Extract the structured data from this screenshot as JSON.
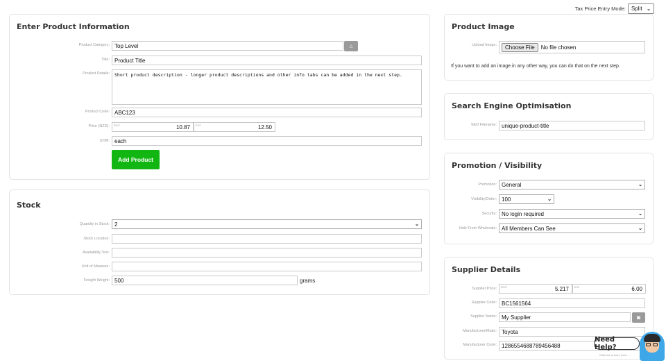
{
  "tax_mode": {
    "label": "Tax Price Entry Mode:",
    "value": "Split"
  },
  "product_info": {
    "title": "Enter Product Information",
    "category_label": "Product Category:",
    "category_value": "Top Level",
    "title_label": "Title:",
    "title_value": "Product Title",
    "details_label": "Product Details:",
    "details_value": "Short product description - longer product descriptions and other info tabs can be added in the next step.",
    "code_label": "Product Code:",
    "code_value": "ABC123",
    "price_label": "Price (NZD):",
    "price_excl_tag": "Excl",
    "price_excl": "10.87",
    "price_incl_tag": "Incl",
    "price_incl": "12.50",
    "uom_label": "UOM:",
    "uom_value": "each",
    "add_button": "Add Product"
  },
  "stock": {
    "title": "Stock",
    "qty_label": "Quantity in Stock:",
    "qty_value": "2",
    "location_label": "Stock Location:",
    "availability_label": "Availability Text:",
    "unit_label": "Unit of Measure:",
    "freight_label": "Freight Weight:",
    "freight_value": "500",
    "freight_unit": "grams"
  },
  "product_image": {
    "title": "Product Image",
    "upload_label": "Upload Image:",
    "choose_button": "Choose File",
    "no_file": "No file chosen",
    "note": "If you want to add an image in any other way, you can do that on the next step."
  },
  "seo": {
    "title": "Search Engine Optimisation",
    "filename_label": "SEO Filename:",
    "filename_value": "unique-product-title"
  },
  "promotion": {
    "title": "Promotion / Visibility",
    "promotion_label": "Promotion:",
    "promotion_value": "General",
    "order_label": "Visibility/Order:",
    "order_value": "100",
    "security_label": "Security:",
    "security_value": "No login required",
    "wholesale_label": "Hide From Wholesale:",
    "wholesale_value": "All Members Can See"
  },
  "supplier": {
    "title": "Supplier Details",
    "price_label": "Supplier Price:",
    "price_excl_tag": "Excl",
    "price_excl": "5.217",
    "price_incl_tag": "Incl",
    "price_incl": "6.00",
    "code_label": "Supplier Code:",
    "code_value": "BC1561564",
    "name_label": "Supplier Name:",
    "name_value": "My Supplier",
    "make_label": "Manufacturer/Make:",
    "make_value": "Toyota",
    "mcode_label": "Manufacturer Code:",
    "mcode_value": "1286554688789456488"
  },
  "help": {
    "label": "Need Help?",
    "sub": "Click me to learn more"
  },
  "icons": {
    "tree": "tree-icon",
    "camera": "camera-icon",
    "chevron": "chevron-down-icon"
  }
}
